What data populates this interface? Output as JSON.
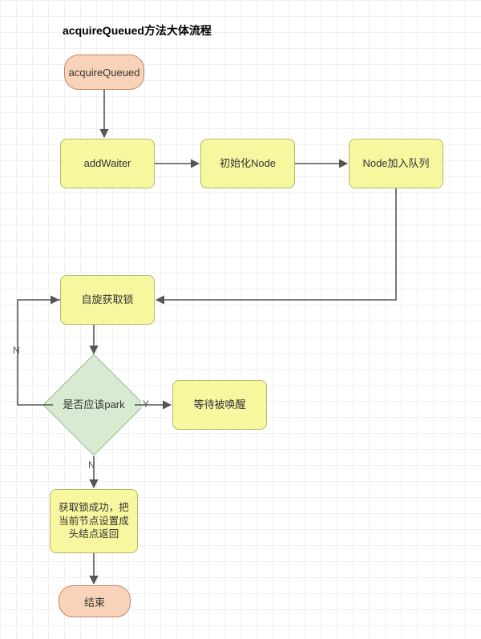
{
  "title": "acquireQueued方法大体流程",
  "nodes": {
    "start": "acquireQueued",
    "addWaiter": "addWaiter",
    "initNode": "初始化Node",
    "enqueue": "Node加入队列",
    "spin": "自旋获取锁",
    "shouldPark": "是否应该park",
    "waitWake": "等待被唤醒",
    "success": "获取锁成功，把当前节点设置成头结点返回",
    "end": "结束"
  },
  "edgeLabels": {
    "park_yes": "Y",
    "park_no": "N",
    "spin_no": "N"
  },
  "chart_data": {
    "type": "flowchart",
    "title": "acquireQueued方法大体流程",
    "nodes": [
      {
        "id": "start",
        "type": "terminator",
        "label": "acquireQueued"
      },
      {
        "id": "addWaiter",
        "type": "process",
        "label": "addWaiter"
      },
      {
        "id": "initNode",
        "type": "process",
        "label": "初始化Node"
      },
      {
        "id": "enqueue",
        "type": "process",
        "label": "Node加入队列"
      },
      {
        "id": "spin",
        "type": "process",
        "label": "自旋获取锁"
      },
      {
        "id": "shouldPark",
        "type": "decision",
        "label": "是否应该park"
      },
      {
        "id": "waitWake",
        "type": "process",
        "label": "等待被唤醒"
      },
      {
        "id": "success",
        "type": "process",
        "label": "获取锁成功，把当前节点设置成头结点返回"
      },
      {
        "id": "end",
        "type": "terminator",
        "label": "结束"
      }
    ],
    "edges": [
      {
        "from": "start",
        "to": "addWaiter"
      },
      {
        "from": "addWaiter",
        "to": "initNode"
      },
      {
        "from": "initNode",
        "to": "enqueue"
      },
      {
        "from": "enqueue",
        "to": "spin"
      },
      {
        "from": "spin",
        "to": "shouldPark"
      },
      {
        "from": "shouldPark",
        "to": "waitWake",
        "label": "Y"
      },
      {
        "from": "shouldPark",
        "to": "success",
        "label": "N"
      },
      {
        "from": "spin",
        "to": "spin",
        "label": "N",
        "note": "loop-back"
      },
      {
        "from": "success",
        "to": "end"
      }
    ]
  }
}
